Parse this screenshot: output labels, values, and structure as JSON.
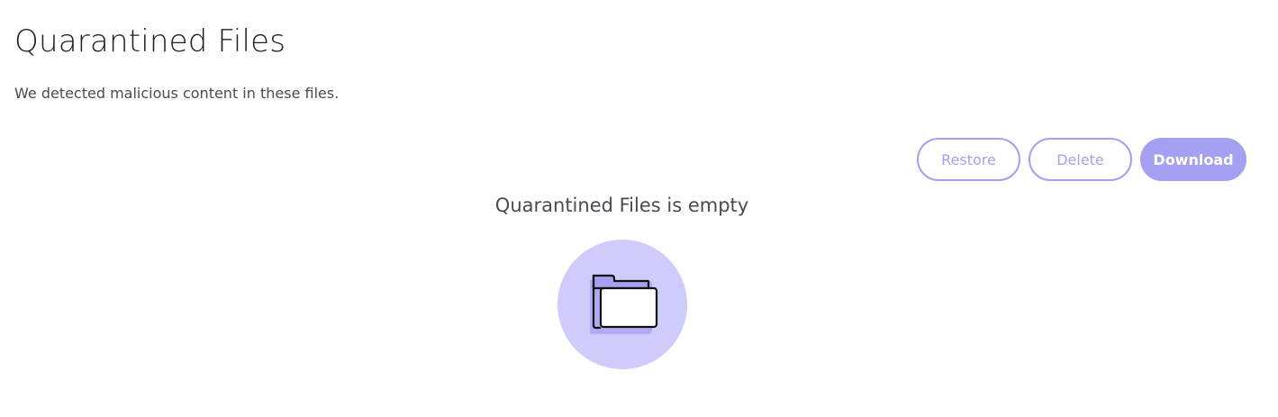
{
  "header": {
    "title": "Quarantined Files",
    "subtitle": "We detected malicious content in these files."
  },
  "toolbar": {
    "restore_label": "Restore",
    "delete_label": "Delete",
    "download_label": "Download"
  },
  "empty_state": {
    "message": "Quarantined Files is empty",
    "icon": "folder-icon"
  },
  "colors": {
    "accent": "#a6a0f2",
    "circle_bg": "#cfccfb",
    "folder_back": "#a6a0f2",
    "text_dark": "#1f1f24",
    "text_muted": "#4a4a55"
  }
}
